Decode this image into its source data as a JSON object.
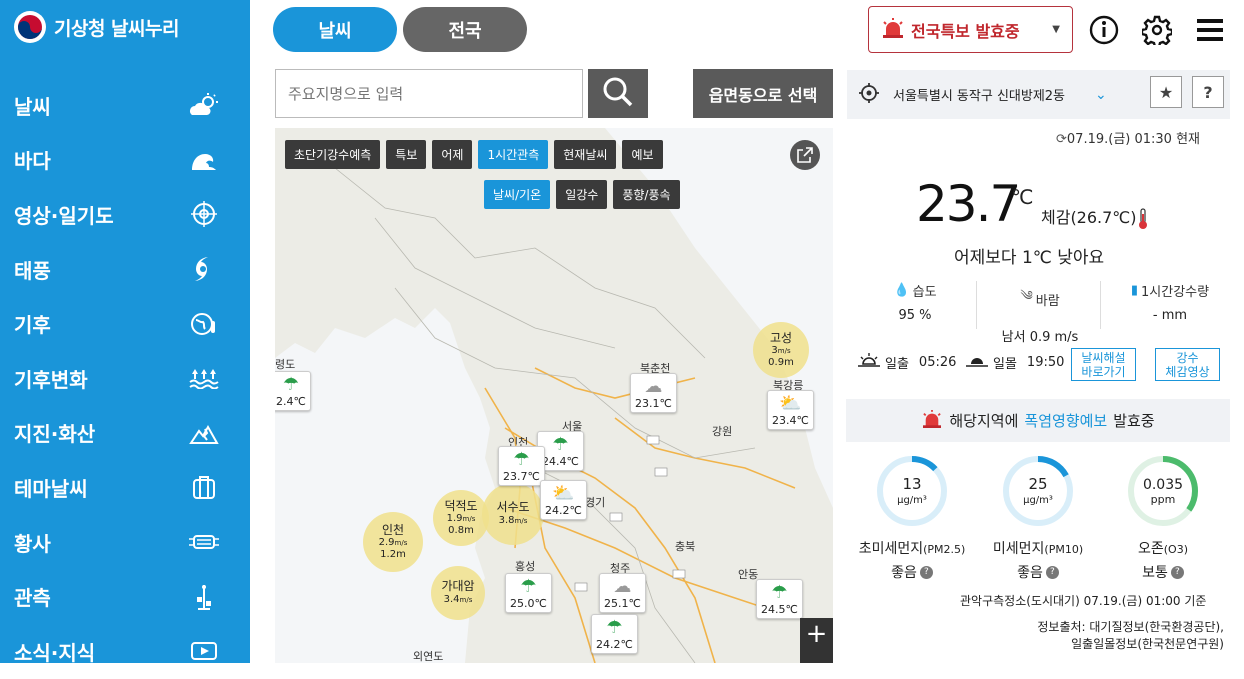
{
  "sidebar": {
    "logo_text": "기상청 날씨누리",
    "items": [
      {
        "label": "날씨",
        "icon": "sun-cloud-icon"
      },
      {
        "label": "바다",
        "icon": "wave-icon"
      },
      {
        "label": "영상·일기도",
        "icon": "satellite-icon"
      },
      {
        "label": "태풍",
        "icon": "typhoon-icon"
      },
      {
        "label": "기후",
        "icon": "globe-thermometer-icon"
      },
      {
        "label": "기후변화",
        "icon": "rising-water-icon"
      },
      {
        "label": "지진·화산",
        "icon": "earthquake-icon"
      },
      {
        "label": "테마날씨",
        "icon": "suitcase-icon"
      },
      {
        "label": "황사",
        "icon": "mask-icon"
      },
      {
        "label": "관측",
        "icon": "observation-tower-icon"
      },
      {
        "label": "소식·지식",
        "icon": "video-play-icon"
      }
    ]
  },
  "header": {
    "tab_weather": "날씨",
    "tab_national": "전국",
    "alert_label": "전국특보 발효중"
  },
  "search": {
    "placeholder": "주요지명으로 입력",
    "dong_button": "읍면동으로 선택"
  },
  "map": {
    "layer_buttons": [
      "초단기강수예측",
      "특보",
      "어제",
      "1시간관측",
      "현재날씨",
      "예보"
    ],
    "sub_buttons": [
      "날씨/기온",
      "일강수",
      "풍향/풍속"
    ],
    "markers": [
      {
        "temp": "2.4℃",
        "icon": "umbrella"
      },
      {
        "temp": "23.1℃",
        "icon": "cloud"
      },
      {
        "temp": "23.4℃",
        "icon": "partly-cloudy"
      },
      {
        "temp": "24.4℃",
        "icon": "umbrella"
      },
      {
        "temp": "23.7℃",
        "icon": "umbrella"
      },
      {
        "temp": "24.2℃",
        "icon": "partly-cloudy"
      },
      {
        "temp": "25.0℃",
        "icon": "umbrella"
      },
      {
        "temp": "25.1℃",
        "icon": "cloud"
      },
      {
        "temp": "24.5℃",
        "icon": "umbrella"
      },
      {
        "temp": "24.2℃",
        "icon": "umbrella"
      }
    ],
    "bubbles": [
      {
        "name": "고성",
        "speed": "3",
        "unit": "m/s",
        "height": "0.9m"
      },
      {
        "name": "덕적도",
        "speed": "1.9",
        "unit": "m/s",
        "height": "0.8m"
      },
      {
        "name": "서수도",
        "speed": "3.8",
        "unit": "m/s",
        "height": ""
      },
      {
        "name": "인천",
        "speed": "2.9",
        "unit": "m/s",
        "height": "1.2m"
      },
      {
        "name": "가대암",
        "speed": "3.4",
        "unit": "m/s",
        "height": ""
      }
    ],
    "places": [
      "북춘천",
      "북강릉",
      "서울",
      "인천",
      "강원",
      "경기",
      "충북",
      "홍성",
      "청주",
      "안동",
      "외연도",
      "령도"
    ]
  },
  "current": {
    "location": "서울특별시 동작구 신대방제2동",
    "time": "07.19.(금) 01:30 현재",
    "temperature": "23.7",
    "temp_unit": "℃",
    "feels_like": "체감(26.7℃)",
    "compare": "어제보다 1℃ 낮아요",
    "humidity_label": "습도",
    "humidity_value": "95 %",
    "wind_label": "바람",
    "wind_value": "남서 0.9 m/s",
    "rain_label": "1시간강수량",
    "rain_value": "- mm",
    "sunrise_label": "일출",
    "sunrise": "05:26",
    "sunset_label": "일몰",
    "sunset": "19:50",
    "btn_commentary": "날씨해설\n바로가기",
    "btn_rain_video": "강수\n체감영상",
    "warning_prefix": "해당지역에",
    "warning_highlight": "폭염영향예보",
    "warning_suffix": "발효중"
  },
  "air": {
    "pm25": {
      "value": "13",
      "unit": "μg/m³",
      "label": "초미세먼지",
      "sub": "(PM2.5)",
      "grade": "좋음",
      "fraction": 0.13,
      "color": "#1a95d9"
    },
    "pm10": {
      "value": "25",
      "unit": "μg/m³",
      "label": "미세먼지",
      "sub": "(PM10)",
      "grade": "좋음",
      "fraction": 0.17,
      "color": "#1a95d9"
    },
    "o3": {
      "value": "0.035",
      "unit": "ppm",
      "label": "오존",
      "sub": "(O3)",
      "grade": "보통",
      "fraction": 0.35,
      "color": "#4cbb6c"
    },
    "station_time": "관악구측정소(도시대기) 07.19.(금) 01:00 기준",
    "source1": "정보출처: 대기질정보(한국환경공단),",
    "source2": "일출일몰정보(한국천문연구원)"
  }
}
